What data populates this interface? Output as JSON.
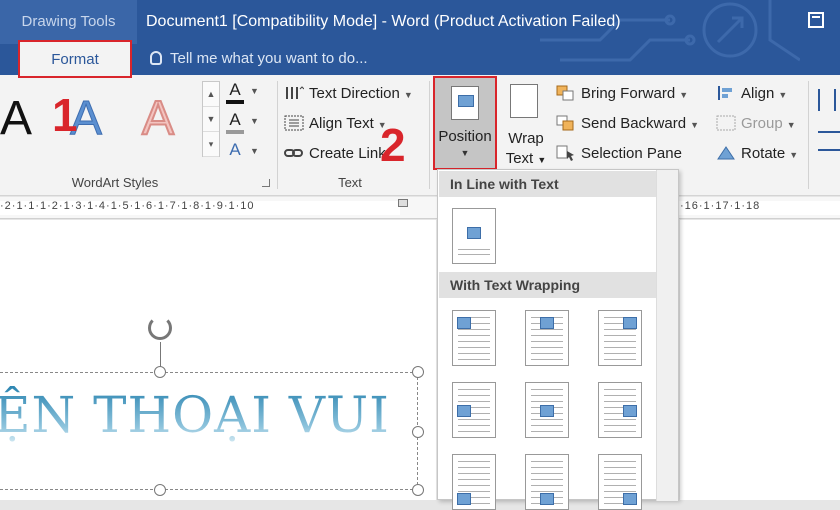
{
  "titlebar": {
    "context_label": "Drawing Tools",
    "document_title": "Document1 [Compatibility Mode] - Word (Product Activation Failed)",
    "tab_format": "Format",
    "tellme_placeholder": "Tell me what you want to do..."
  },
  "ribbon": {
    "wordart": {
      "samples": [
        "A",
        "A",
        "A"
      ],
      "group_label": "WordArt Styles"
    },
    "text_group": {
      "text_direction": "Text Direction",
      "align_text": "Align Text",
      "create_link": "Create Link",
      "group_label": "Text"
    },
    "arrange": {
      "position": "Position",
      "wrap_text_line1": "Wrap",
      "wrap_text_line2": "Text",
      "bring_forward": "Bring Forward",
      "send_backward": "Send Backward",
      "selection_pane": "Selection Pane",
      "align": "Align",
      "group": "Group",
      "rotate": "Rotate"
    }
  },
  "ruler": {
    "left_numbers": "·2·1·1·1·2·1·3·1·4·1·5·1·6·1·7·1·8·1·9·1·10",
    "right_numbers": "·16·1·17·1·18"
  },
  "document": {
    "wordart_text": "ỆN THOẠI VUI"
  },
  "annotations": {
    "step1": "1",
    "step2": "2",
    "color": "#d9252b"
  },
  "position_menu": {
    "inline_header": "In Line with Text",
    "wrapping_header": "With Text Wrapping"
  },
  "colors": {
    "titlebar": "#2b579a",
    "ribbon": "#f3f3f3",
    "highlight": "#d9252b"
  }
}
